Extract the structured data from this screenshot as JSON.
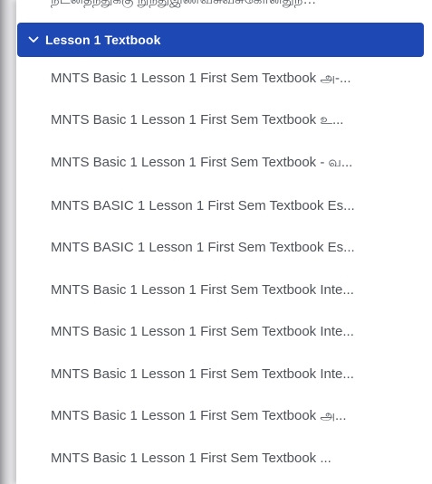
{
  "cutoff_item": "நடனதநதுக்கு நுநதுஇண்வசுவசுகோனதுந…",
  "section": {
    "title": "Lesson 1 Textbook"
  },
  "items": [
    "MNTS Basic 1 Lesson 1 First Sem Textbook அ-...",
    "MNTS Basic 1 Lesson 1 First Sem Textbook உ...",
    "MNTS Basic 1 Lesson 1 First Sem Textbook - வ...",
    "MNTS BASIC 1 Lesson 1 First Sem Textbook Es...",
    "MNTS BASIC 1 Lesson 1 First Sem Textbook Es...",
    "MNTS Basic 1 Lesson 1 First Sem Textbook Inte...",
    "MNTS Basic 1 Lesson 1 First Sem Textbook Inte...",
    "MNTS Basic 1 Lesson 1 First Sem Textbook Inte...",
    "MNTS Basic 1 Lesson 1 First Sem Textbook அ...",
    "MNTS Basic 1 Lesson 1 First Sem Textbook ..."
  ]
}
